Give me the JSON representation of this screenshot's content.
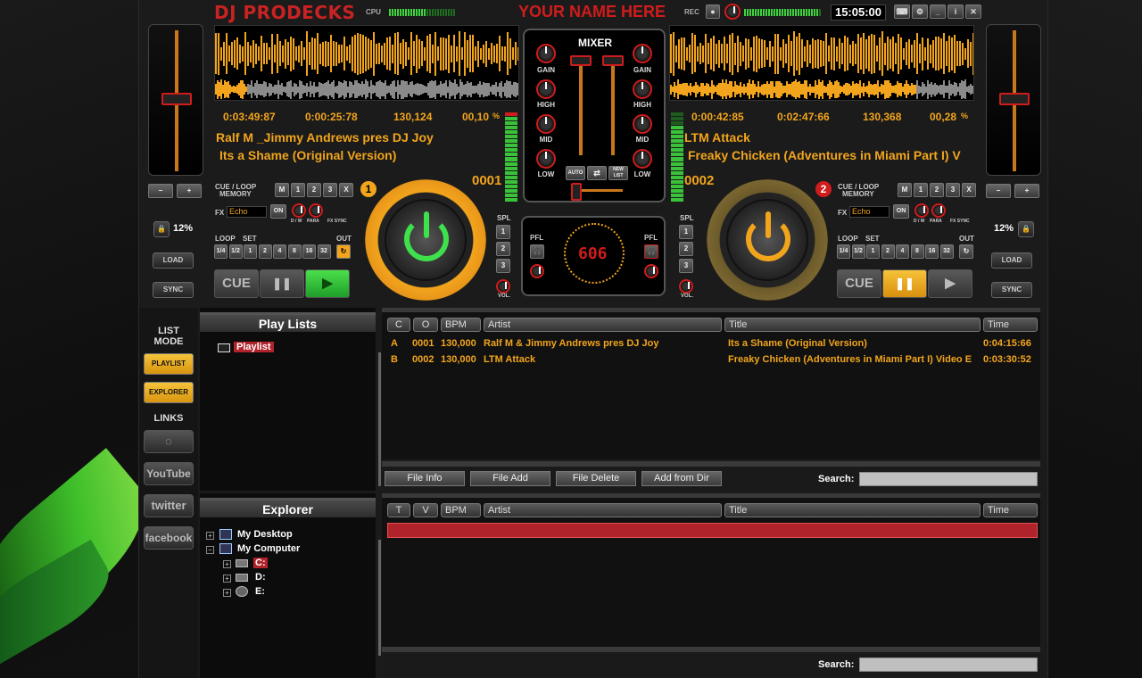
{
  "app": {
    "logo": "DJ PRODECKS",
    "cpu_label": "CPU",
    "name_banner": "YOUR NAME HERE",
    "rec_label": "REC",
    "clock": "15:05:00"
  },
  "deck1": {
    "number_badge": "1",
    "time_elapsed": "0:03:49:87",
    "time_remaining": "0:00:25:78",
    "bpm": "130,124",
    "pitch": "00,10",
    "pitch_unit": "%",
    "artist": "Ralf M _Jimmy Andrews pres DJ Joy",
    "title": "Its a Shame (Original Version)",
    "track_number": "0001",
    "pitch_percent": "12%",
    "fx_value": "Echo",
    "play_state": "stopped"
  },
  "deck2": {
    "number_badge": "2",
    "time_elapsed": "0:00:42:85",
    "time_remaining": "0:02:47:66",
    "bpm": "130,368",
    "pitch": "00,28",
    "pitch_unit": "%",
    "artist": "LTM Attack",
    "title": "Freaky Chicken (Adventures in Miami Part I) V",
    "track_number": "0002",
    "pitch_percent": "12%",
    "fx_value": "Echo",
    "play_state": "paused"
  },
  "deck_labels": {
    "cue_loop": "CUE / LOOP",
    "memory": "MEMORY",
    "mem_slots": [
      "M",
      "1",
      "2",
      "3",
      "X"
    ],
    "fx": "FX",
    "on": "ON",
    "dw": "D / W",
    "para": "PARA",
    "fx_sync": "FX SYNC",
    "loop": "LOOP",
    "set": "SET",
    "out": "OUT",
    "loop_sizes": [
      "1/4",
      "1/2",
      "1",
      "2",
      "4",
      "8",
      "16",
      "32"
    ],
    "cue": "CUE",
    "pause": "❚❚",
    "play": "▶",
    "load": "LOAD",
    "sync": "SYNC",
    "minus": "−",
    "plus": "+"
  },
  "mixer": {
    "title": "MIXER",
    "gain": "GAIN",
    "high": "HIGH",
    "mid": "MID",
    "low": "LOW",
    "auto": "AUTO",
    "new_list": "NEW LIST",
    "spl": "SPL",
    "spl_buttons": [
      "1",
      "2",
      "3"
    ],
    "vol": "VOL.",
    "pfl": "PFL",
    "display": "606"
  },
  "sidebar": {
    "list_mode": "LIST MODE",
    "playlist_btn": "PLAYLIST",
    "explorer_btn": "EXPLORER",
    "links": "LINKS",
    "youtube": "YouTube",
    "twitter": "twitter",
    "facebook": "facebook"
  },
  "playlists": {
    "header": "Play Lists",
    "items": [
      "Playlist"
    ]
  },
  "playlist_table": {
    "columns": [
      "C",
      "O",
      "BPM",
      "Artist",
      "Title",
      "Time"
    ],
    "rows": [
      [
        "A",
        "0001",
        "130,000",
        "Ralf M & Jimmy Andrews pres DJ Joy",
        "Its a Shame (Original Version)",
        "0:04:15:66"
      ],
      [
        "B",
        "0002",
        "130,000",
        "LTM Attack",
        "Freaky Chicken (Adventures in Miami Part I) Video E",
        "0:03:30:52"
      ]
    ],
    "buttons": [
      "File Info",
      "File Add",
      "File Delete",
      "Add from Dir"
    ],
    "search_label": "Search:",
    "search_value": ""
  },
  "explorer": {
    "header": "Explorer",
    "tree": [
      "My Desktop",
      "My Computer",
      "C:",
      "D:",
      "E:"
    ],
    "columns": [
      "T",
      "V",
      "BPM",
      "Artist",
      "Title",
      "Time"
    ],
    "search_label": "Search:",
    "search_value": ""
  },
  "colors": {
    "accent_orange": "#f2a51c",
    "accent_red": "#d01c1c",
    "play_green": "#2fbf3a"
  }
}
